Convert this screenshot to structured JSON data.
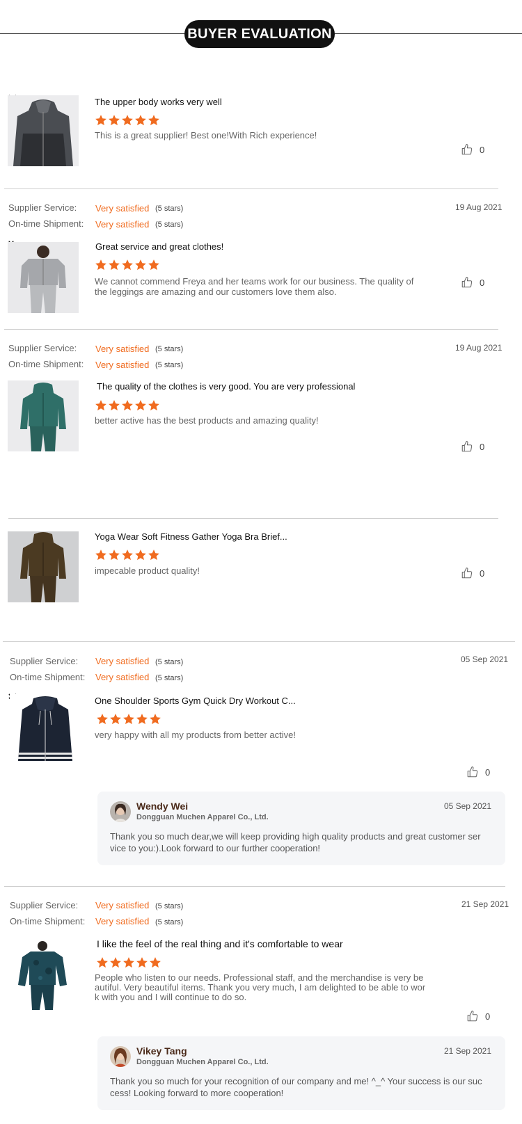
{
  "header": {
    "title": "BUYER EVALUATION"
  },
  "labels": {
    "supplier_service": "Supplier Service:",
    "on_time_shipment": "On-time Shipment:",
    "very_satisfied": "Very satisfied",
    "five_stars": "(5 stars)"
  },
  "colors": {
    "accent_orange": "#f06b1f",
    "title_pill": "#111111",
    "divider": "#cfcfcf",
    "reply_background": "#f5f6f8"
  },
  "reviews": [
    {
      "product_title": "The upper body works very well",
      "rating": 5,
      "comment": "This is a great supplier! Best one!With Rich experience!",
      "likes": "0",
      "image_icon": "gray-hoodie-icon"
    },
    {
      "date": "19 Aug 2021",
      "supplier_service": "Very satisfied",
      "on_time_shipment": "Very satisfied",
      "product_title": "Great service and great clothes!",
      "rating": 5,
      "comment": "We cannot commend Freya and her teams work for our business. The quality of the leggings are amazing and our customers love them also.",
      "likes": "0",
      "image_icon": "light-gray-tracksuit-icon"
    },
    {
      "date": "19 Aug 2021",
      "supplier_service": "Very satisfied",
      "on_time_shipment": "Very satisfied",
      "product_title": "The quality of the clothes is very good. You are very professional",
      "rating": 5,
      "comment": "better active has the best products and amazing quality!",
      "likes": "0",
      "image_icon": "teal-tracksuit-icon"
    },
    {
      "product_title": "Yoga Wear Soft Fitness Gather Yoga Bra Brief...",
      "rating": 5,
      "comment": "impecable product quality!",
      "likes": "0",
      "image_icon": "olive-tracksuit-icon"
    },
    {
      "date": "05 Sep 2021",
      "supplier_service": "Very satisfied",
      "on_time_shipment": "Very satisfied",
      "product_title": "One Shoulder Sports Gym Quick Dry Workout C...",
      "rating": 5,
      "comment": "very happy with all my products from better active!",
      "likes": "0",
      "image_icon": "navy-varsity-jacket-icon",
      "reply": {
        "name": "Wendy Wei",
        "company": "Dongguan Muchen Apparel Co., Ltd.",
        "date": "05 Sep 2021",
        "text": "Thank you so much dear,we will keep providing high quality products and great customer service to you:).Look forward to our further cooperation!"
      }
    },
    {
      "date": "21 Sep 2021",
      "supplier_service": "Very satisfied",
      "on_time_shipment": "Very satisfied",
      "product_title": "I like the feel of the real thing and it's comfortable to wear",
      "rating": 5,
      "comment": "People who listen to our needs. Professional staff, and the merchandise is very beautiful. Very beautiful items. Thank you very much, I am delighted to be able to work with you and I will continue to do so.",
      "likes": "0",
      "image_icon": "camo-tracksuit-icon",
      "reply": {
        "name": "Vikey Tang",
        "company": "Dongguan Muchen Apparel Co., Ltd.",
        "date": "21 Sep 2021",
        "text": "Thank you so much for your recognition of our company and me!  ^_^ Your success is our success! Looking forward to more cooperation!"
      }
    }
  ]
}
